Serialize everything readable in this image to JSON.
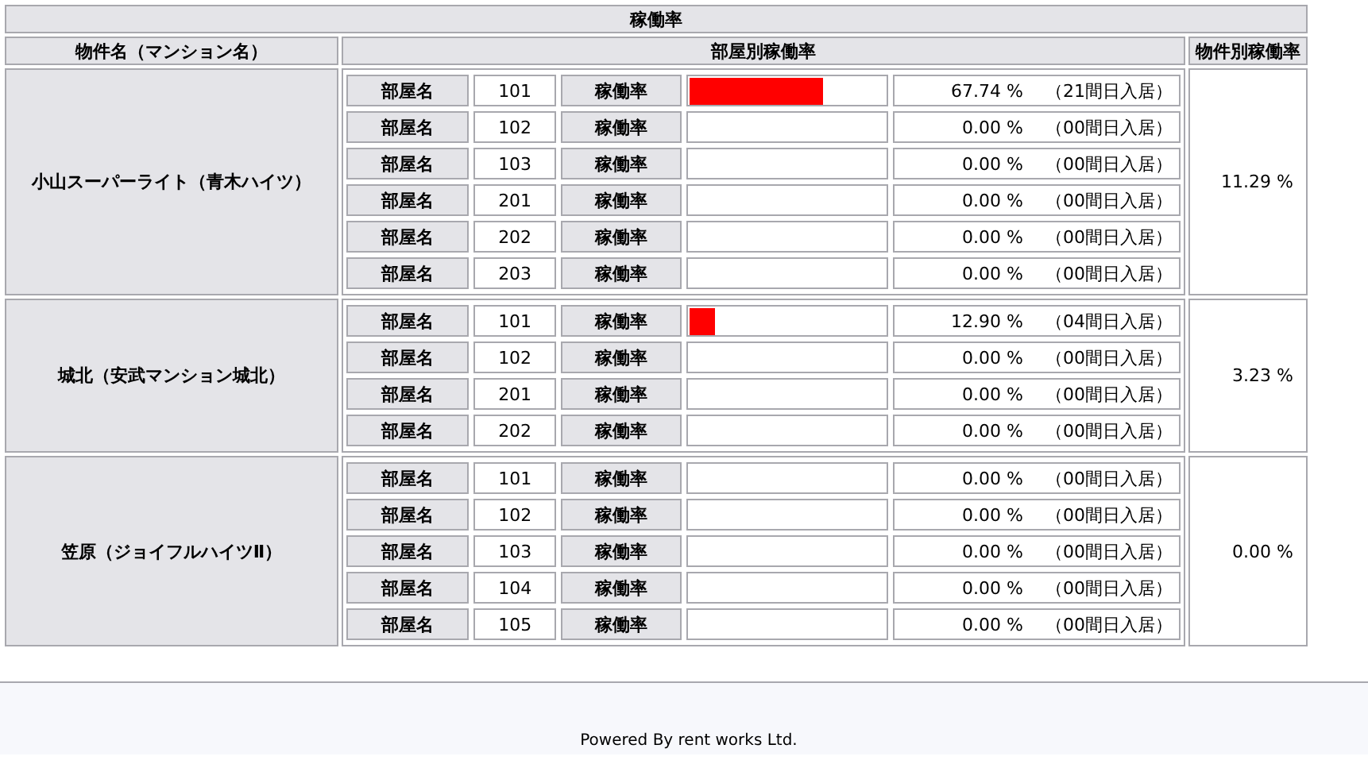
{
  "title": "稼働率",
  "columns": [
    "物件名（マンション名）",
    "部屋別稼働率",
    "物件別稼働率"
  ],
  "properties": [
    {
      "name": "小山スーパーライト（青木ハイツ）",
      "overall_rate": "11.29 %",
      "rooms": [
        {
          "label": "部屋名",
          "room": "101",
          "rate_label": "稼働率",
          "level": 0.6774,
          "rate": "67.74 %",
          "note": "（21間日入居）"
        },
        {
          "label": "部屋名",
          "room": "102",
          "rate_label": "稼働率",
          "level": 0,
          "rate": "0.00 %",
          "note": "（00間日入居）"
        },
        {
          "label": "部屋名",
          "room": "103",
          "rate_label": "稼働率",
          "level": 0,
          "rate": "0.00 %",
          "note": "（00間日入居）"
        },
        {
          "label": "部屋名",
          "room": "201",
          "rate_label": "稼働率",
          "level": 0,
          "rate": "0.00 %",
          "note": "（00間日入居）"
        },
        {
          "label": "部屋名",
          "room": "202",
          "rate_label": "稼働率",
          "level": 0,
          "rate": "0.00 %",
          "note": "（00間日入居）"
        },
        {
          "label": "部屋名",
          "room": "203",
          "rate_label": "稼働率",
          "level": 0,
          "rate": "0.00 %",
          "note": "（00間日入居）"
        }
      ]
    },
    {
      "name": "城北（安武マンション城北）",
      "overall_rate": "3.23 %",
      "rooms": [
        {
          "label": "部屋名",
          "room": "101",
          "rate_label": "稼働率",
          "level": 0.129,
          "rate": "12.90 %",
          "note": "（04間日入居）"
        },
        {
          "label": "部屋名",
          "room": "102",
          "rate_label": "稼働率",
          "level": 0,
          "rate": "0.00 %",
          "note": "（00間日入居）"
        },
        {
          "label": "部屋名",
          "room": "201",
          "rate_label": "稼働率",
          "level": 0,
          "rate": "0.00 %",
          "note": "（00間日入居）"
        },
        {
          "label": "部屋名",
          "room": "202",
          "rate_label": "稼働率",
          "level": 0,
          "rate": "0.00 %",
          "note": "（00間日入居）"
        }
      ]
    },
    {
      "name": "笠原（ジョイフルハイツⅡ）",
      "overall_rate": "0.00 %",
      "rooms": [
        {
          "label": "部屋名",
          "room": "101",
          "rate_label": "稼働率",
          "level": 0,
          "rate": "0.00 %",
          "note": "（00間日入居）"
        },
        {
          "label": "部屋名",
          "room": "102",
          "rate_label": "稼働率",
          "level": 0,
          "rate": "0.00 %",
          "note": "（00間日入居）"
        },
        {
          "label": "部屋名",
          "room": "103",
          "rate_label": "稼働率",
          "level": 0,
          "rate": "0.00 %",
          "note": "（00間日入居）"
        },
        {
          "label": "部屋名",
          "room": "104",
          "rate_label": "稼働率",
          "level": 0,
          "rate": "0.00 %",
          "note": "（00間日入居）"
        },
        {
          "label": "部屋名",
          "room": "105",
          "rate_label": "稼働率",
          "level": 0,
          "rate": "0.00 %",
          "note": "（00間日入居）"
        }
      ]
    }
  ],
  "footer": "Powered By rent works Ltd."
}
